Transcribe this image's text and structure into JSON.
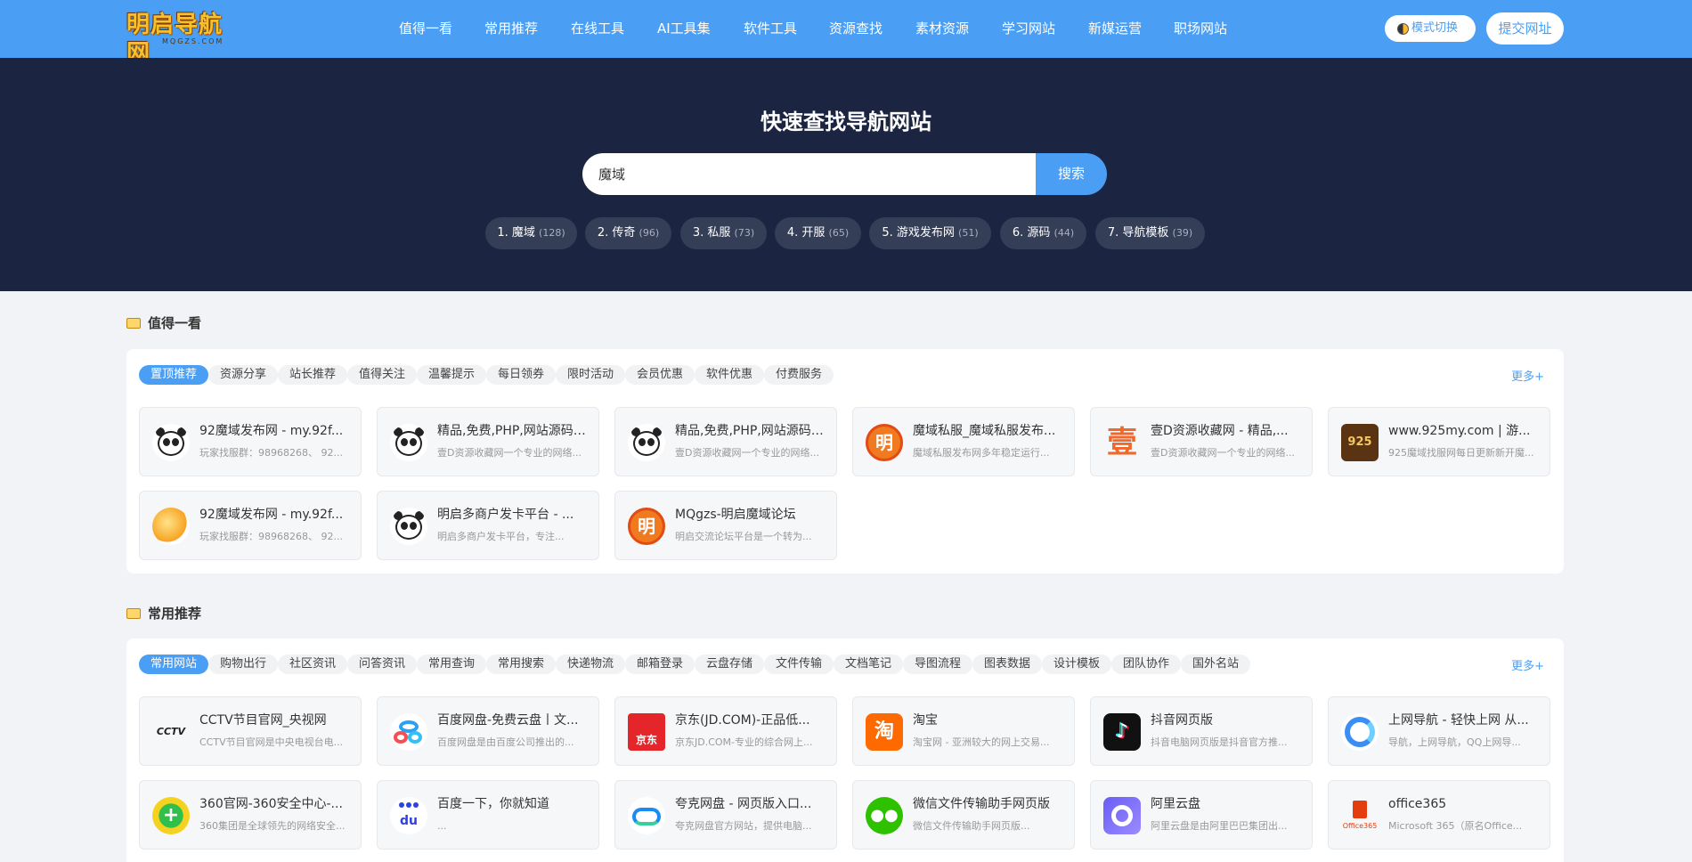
{
  "header": {
    "logo_text": "明启导航网",
    "logo_sub": "MQGZS.COM",
    "nav": [
      "值得一看",
      "常用推荐",
      "在线工具",
      "AI工具集",
      "软件工具",
      "资源查找",
      "素材资源",
      "学习网站",
      "新媒运营",
      "职场网站"
    ],
    "mode_label": "模式切换",
    "submit_label": "提交网址"
  },
  "hero": {
    "title": "快速查找导航网站",
    "search_value": "魔域",
    "search_button": "搜索",
    "hot": [
      {
        "label": "1. 魔域",
        "count": "(128)"
      },
      {
        "label": "2. 传奇",
        "count": "(96)"
      },
      {
        "label": "3. 私服",
        "count": "(73)"
      },
      {
        "label": "4. 开服",
        "count": "(65)"
      },
      {
        "label": "5. 游戏发布网",
        "count": "(51)"
      },
      {
        "label": "6. 源码",
        "count": "(44)"
      },
      {
        "label": "7. 导航模板",
        "count": "(39)"
      }
    ]
  },
  "sections": [
    {
      "title": "值得一看",
      "more": "更多+",
      "tabs": [
        "置顶推荐",
        "资源分享",
        "站长推荐",
        "值得关注",
        "温馨提示",
        "每日领券",
        "限时活动",
        "会员优惠",
        "软件优惠",
        "付费服务"
      ],
      "sites": [
        {
          "name": "92魔域发布网 - my.92f...",
          "desc": "玩家找服群：98968268、 92...",
          "icon": "panda-icon"
        },
        {
          "name": "精品,免费,PHP,网站源码,...",
          "desc": "壹D资源收藏网一个专业的网络...",
          "icon": "panda-icon"
        },
        {
          "name": "精品,免费,PHP,网站源码,...",
          "desc": "壹D资源收藏网一个专业的网络...",
          "icon": "panda-icon"
        },
        {
          "name": "魔域私服_魔域私服发布...",
          "desc": "魔域私服发布网多年稳定运行...",
          "icon": "ming-icon"
        },
        {
          "name": "壹D资源收藏网 - 精品,...",
          "desc": "壹D资源收藏网一个专业的网络...",
          "icon": "yi-icon"
        },
        {
          "name": "www.925my.com | 游...",
          "desc": "925魔域找服网每日更新新开魔...",
          "icon": "925-icon"
        },
        {
          "name": "92魔域发布网 - my.92f...",
          "desc": "玩家找服群：98968268、 92...",
          "icon": "sun-icon"
        },
        {
          "name": "明启多商户发卡平台 - ...",
          "desc": "明启多商户发卡平台，专注...",
          "icon": "panda-icon"
        },
        {
          "name": "MQgzs-明启魔域论坛",
          "desc": "明启交流论坛平台是一个转为...",
          "icon": "ming-icon"
        }
      ]
    },
    {
      "title": "常用推荐",
      "more": "更多+",
      "tabs": [
        "常用网站",
        "购物出行",
        "社区资讯",
        "问答资讯",
        "常用查询",
        "常用搜索",
        "快递物流",
        "邮箱登录",
        "云盘存储",
        "文件传输",
        "文档笔记",
        "导图流程",
        "图表数据",
        "设计模板",
        "团队协作",
        "国外名站"
      ],
      "sites": [
        {
          "name": "CCTV节目官网_央视网",
          "desc": "CCTV节目官网是中央电视台电...",
          "icon": "cctv-icon"
        },
        {
          "name": "百度网盘-免费云盘丨文...",
          "desc": "百度网盘是由百度公司推出的...",
          "icon": "baidu-pan-icon"
        },
        {
          "name": "京东(JD.COM)-正品低...",
          "desc": "京东JD.COM-专业的综合网上...",
          "icon": "jd-icon"
        },
        {
          "name": "淘宝",
          "desc": "淘宝网 - 亚洲较大的网上交易...",
          "icon": "taobao-icon"
        },
        {
          "name": "抖音网页版",
          "desc": "抖音电脑网页版是抖音官方推...",
          "icon": "douyin-icon"
        },
        {
          "name": "上网导航 - 轻快上网 从...",
          "desc": "导航，上网导航，QQ上网导...",
          "icon": "qq-nav-icon"
        },
        {
          "name": "360官网-360安全中心-...",
          "desc": "360集团是全球领先的网络安全...",
          "icon": "360-icon"
        },
        {
          "name": "百度一下，你就知道",
          "desc": "...",
          "icon": "baidu-icon"
        },
        {
          "name": "夸克网盘 - 网页版入口...",
          "desc": "夸克网盘官方网站，提供电脑...",
          "icon": "quark-icon"
        },
        {
          "name": "微信文件传输助手网页版",
          "desc": "微信文件传输助手网页版...",
          "icon": "wechat-icon"
        },
        {
          "name": "阿里云盘",
          "desc": "阿里云盘是由阿里巴巴集团出...",
          "icon": "aliyun-icon"
        },
        {
          "name": "office365",
          "desc": "Microsoft 365（原名Office...",
          "icon": "office-icon"
        }
      ]
    }
  ],
  "icon_labels": {
    "ming": "明",
    "yi": "壹",
    "n925": "925",
    "cctv": "CCTV",
    "jd": "京东",
    "taobao": "淘",
    "baidu": "du",
    "office": "Office365"
  },
  "colors": {
    "header_bg": "#4a9ff5",
    "hero_bg": "#1b2440",
    "accent": "#4a9ff5"
  }
}
